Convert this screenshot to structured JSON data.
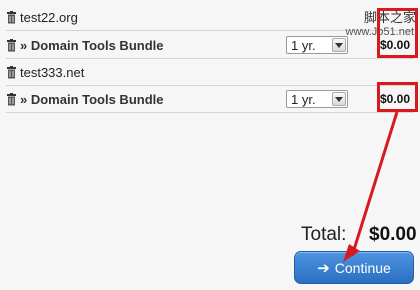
{
  "cart": {
    "items": [
      {
        "domain": "test22.org",
        "product": "» Domain Tools Bundle",
        "period": "1 yr.",
        "price": "$0.00"
      },
      {
        "domain": "test333.net",
        "product": "» Domain Tools Bundle",
        "period": "1 yr.",
        "price": "$0.00"
      }
    ]
  },
  "summary": {
    "total_label": "Total:",
    "total_amount": "$0.00"
  },
  "actions": {
    "continue_label": "Continue"
  },
  "watermark": {
    "text": "脚本之家",
    "url": "www.Jb51.net"
  },
  "colors": {
    "highlight": "#d8191f",
    "button": "#2f7dd8"
  },
  "icons": {
    "remove": "trash-icon",
    "continue": "arrow-right-icon"
  }
}
